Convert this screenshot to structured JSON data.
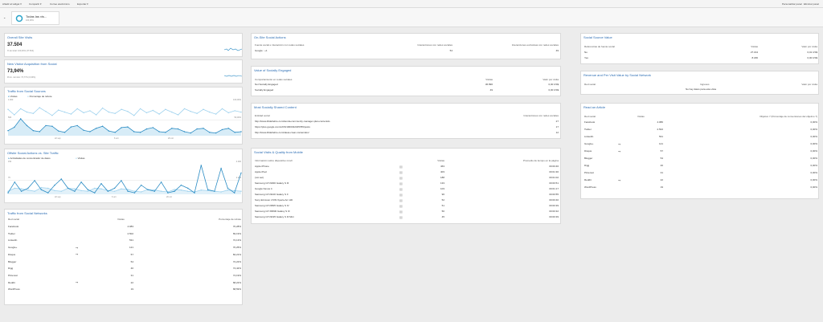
{
  "toolbar": {
    "left": [
      "Añadir al widget",
      "Compartir",
      "Correo electrónico",
      "Exportar"
    ],
    "right": [
      "Personalizar panel",
      "Eliminar panel"
    ]
  },
  "segment": {
    "label": "Todas las vis...",
    "pct": "100,00%"
  },
  "overall": {
    "title": "Overall Site Visits",
    "value": "37.504",
    "sub": "% del total: 100,00% (37.504)"
  },
  "nva": {
    "title": "New Visitor Acquisition from Social",
    "value": "73,94%",
    "sub": "Prom. del sitio: 73,77% (0,63%)"
  },
  "tss": {
    "title": "Traffic from Social Sources",
    "legend": [
      "Visitas",
      "Porcentaje de rebote"
    ],
    "ylabels": [
      "1.000",
      "100,00%",
      "500",
      "50,00%"
    ],
    "xlabels": [
      "22 sep",
      "6 oct",
      "20 oct"
    ]
  },
  "osa": {
    "title": "Offsite Social Actions vs. Site Traffic",
    "legend": [
      "Actividades de concentrador de datos",
      "Visitas"
    ],
    "ylabels": [
      "150",
      "4.000",
      "75",
      "2.000"
    ],
    "xlabels": [
      "22 sep",
      "6 oct",
      "20 oct"
    ]
  },
  "tsn": {
    "title": "Traffic from Social Networks",
    "cols": [
      "Red social",
      "Visitas",
      "Porcentaje de rebote"
    ],
    "rows": [
      [
        "Facebook",
        "4.083",
        "70,28%"
      ],
      [
        "Twitter",
        "2.502",
        "69,19%"
      ],
      [
        "LinkedIn",
        "531",
        "72,13%"
      ],
      [
        "Google+",
        "121",
        "70,25%"
      ],
      [
        "Disqus",
        "57",
        "84,21%"
      ],
      [
        "Blogger",
        "54",
        "72,22%"
      ],
      [
        "Digg",
        "40",
        "74,42%"
      ],
      [
        "Pinterest",
        "31",
        "74,19%"
      ],
      [
        "Reddit",
        "22",
        "68,22%"
      ],
      [
        "WordPress",
        "19",
        "68,59%"
      ]
    ]
  },
  "onsite": {
    "title": "On-Site Social Actions",
    "cols": [
      "Fuente social e interacción con redes sociales",
      "Interacciones con redes sociales",
      "Interacciones exclusivas con redes sociales"
    ],
    "rows": [
      [
        "Google : +1",
        "54",
        "49"
      ]
    ]
  },
  "value": {
    "title": "Value of Socially Engaged",
    "cols": [
      "Comportamiento en redes sociales",
      "Visitas",
      "Valor por visita"
    ],
    "rows": [
      [
        "Not Socially Engaged",
        "36.896",
        "0,00 US$"
      ],
      [
        "Socially Engaged",
        "49",
        "0,00 US$"
      ]
    ]
  },
  "shared": {
    "title": "Most Socially Shared Content",
    "cols": [
      "Entidad social",
      "Interacciones con redes sociales"
    ],
    "rows": [
      [
        "http://www.40defiebre.com/tienda-community-manager-plan-contenido",
        "27"
      ],
      [
        "https://plus.google.com/u/0/b/1000432345786/posts",
        "17"
      ],
      [
        "http://www.40defiebre.com/ideas-crear-contenidos/",
        "12"
      ]
    ]
  },
  "mobile": {
    "title": "Social Visits & Quality from Mobile",
    "cols": [
      "Información sobre dispositivo móvil",
      "Visitas",
      "Promedio de tiempo en la página"
    ],
    "rows": [
      [
        "Apple iPhone",
        "463",
        "00:00:46"
      ],
      [
        "Apple iPad",
        "403",
        "00:01:30"
      ],
      [
        "(not set)",
        "188",
        "00:01:02"
      ],
      [
        "Samsung GT-I9300 Galaxy S III",
        "133",
        "00:00:51"
      ],
      [
        "Google Nexus 4",
        "103",
        "00:01:17"
      ],
      [
        "Samsung GT-I9100 Galaxy S II",
        "96",
        "00:00:55"
      ],
      [
        "Sony Ericsson LT26i Xperia Arc HD",
        "52",
        "00:00:40"
      ],
      [
        "Samsung GT-I9505 Galaxy S IV",
        "51",
        "00:00:39"
      ],
      [
        "Samsung GT-S5830 Galaxy S III",
        "50",
        "00:00:32"
      ],
      [
        "Samsung GT-I9195 Galaxy S III Mini",
        "45",
        "00:00:39"
      ]
    ]
  },
  "ssv": {
    "title": "Social Source Value",
    "cols": [
      "Referencias de fuente social",
      "Visitas",
      "Valor por visita"
    ],
    "rows": [
      [
        "No",
        "27.164",
        "0,01 US$"
      ],
      [
        "Yes",
        "8.180",
        "0,00 US$"
      ]
    ]
  },
  "rpv": {
    "title": "Revenue and Per Visit Value by Social Network",
    "cols": [
      "Red social",
      "Ingresos",
      "Valor por visita"
    ],
    "empty": "No hay datos para esta vista"
  },
  "rao": {
    "title": "Read an Article",
    "cols": [
      "Red social",
      "Visitas",
      "Objetivo 7 (Porcentaje de conversiones del objetivo 7)"
    ],
    "rows": [
      [
        "Facebook",
        "4.080",
        "0,00%"
      ],
      [
        "Twitter",
        "2.502",
        "0,00%"
      ],
      [
        "LinkedIn",
        "531",
        "0,00%"
      ],
      [
        "Google+",
        "121",
        "0,00%"
      ],
      [
        "Disqus",
        "57",
        "0,00%"
      ],
      [
        "Blogger",
        "54",
        "0,00%"
      ],
      [
        "Digg",
        "40",
        "0,00%"
      ],
      [
        "Pinterest",
        "31",
        "0,00%"
      ],
      [
        "Reddit",
        "22",
        "0,00%"
      ],
      [
        "WordPress",
        "19",
        "0,00%"
      ]
    ]
  },
  "colors": {
    "accent": "#2a6cb3",
    "series1": "#2b8cc4",
    "series2": "#9fd2ee"
  }
}
